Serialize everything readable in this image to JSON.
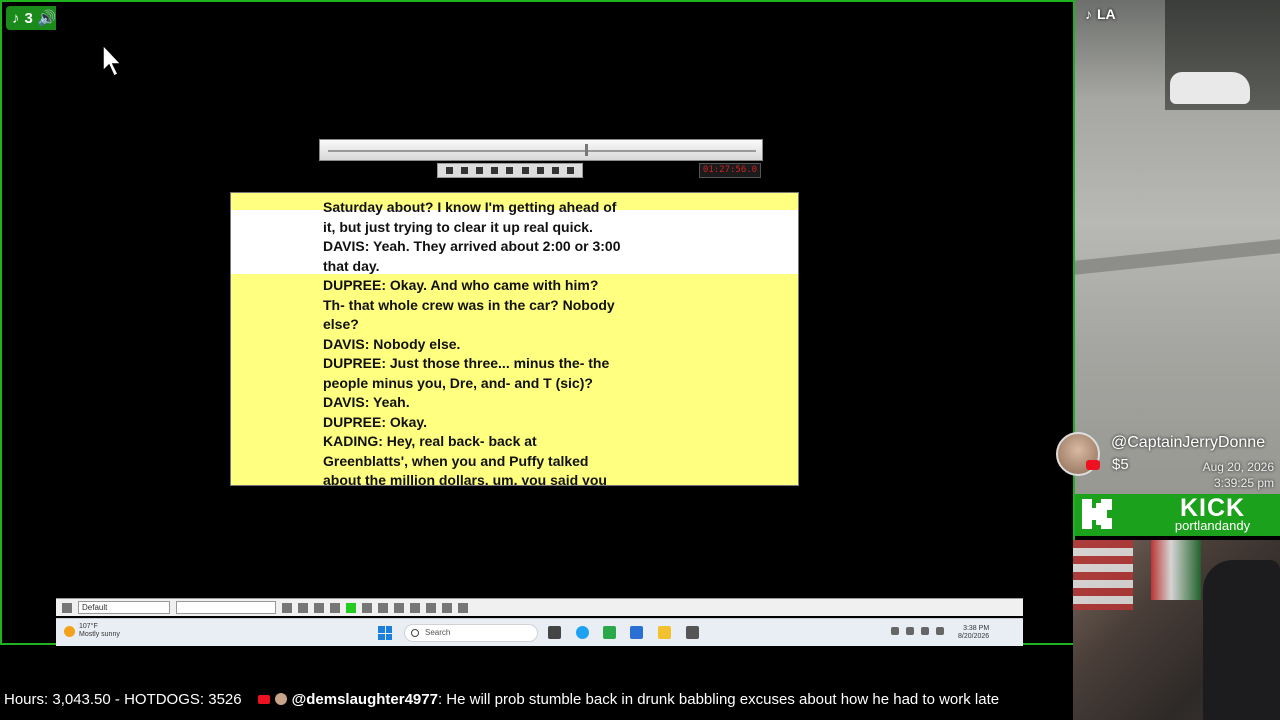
{
  "overlay": {
    "tiktok_viewers": "3",
    "tiktok_region": "LA"
  },
  "player": {
    "time_display": "01:27:56.0"
  },
  "transcript": {
    "lines": [
      "Saturday about? I know I'm getting ahead of",
      "it, but just trying to clear it up real quick.",
      "DAVIS: Yeah. They arrived about 2:00 or 3:00",
      "that day.",
      "DUPREE: Okay. And who came with him?",
      "Th- that whole crew was in the car? Nobody",
      "else?",
      "DAVIS: Nobody else.",
      "DUPREE: Just those three... minus the- the",
      "people minus you, Dre, and- and T (sic)?",
      "DAVIS: Yeah.",
      "DUPREE: Okay.",
      "KADING: Hey, real back- back at",
      "Greenblatts', when you and Puffy talked",
      "about the million dollars, um, you said you"
    ]
  },
  "app_toolbar": {
    "style_select": "Default"
  },
  "taskbar": {
    "weather_temp": "107°F",
    "weather_desc": "Mostly sunny",
    "search_placeholder": "Search",
    "clock_time": "3:38 PM",
    "clock_date": "8/20/2026"
  },
  "donation": {
    "name": "@CaptainJerryDonne",
    "amount": "$5",
    "date": "Aug 20, 2026",
    "time": "3:39:25 pm"
  },
  "kick": {
    "title": "KICK",
    "channel": "portlandandy"
  },
  "ticker": {
    "stats": "Hours: 3,043.50 - HOTDOGS: 3526",
    "chat_user": "@demslaughter4977",
    "chat_message": ": He will prob stumble back in drunk babbling excuses about how he had to work late"
  },
  "colors": {
    "frame_green": "#1fb31f",
    "kick_green": "#1ba11b",
    "transcript_yellow": "#ffff80"
  }
}
